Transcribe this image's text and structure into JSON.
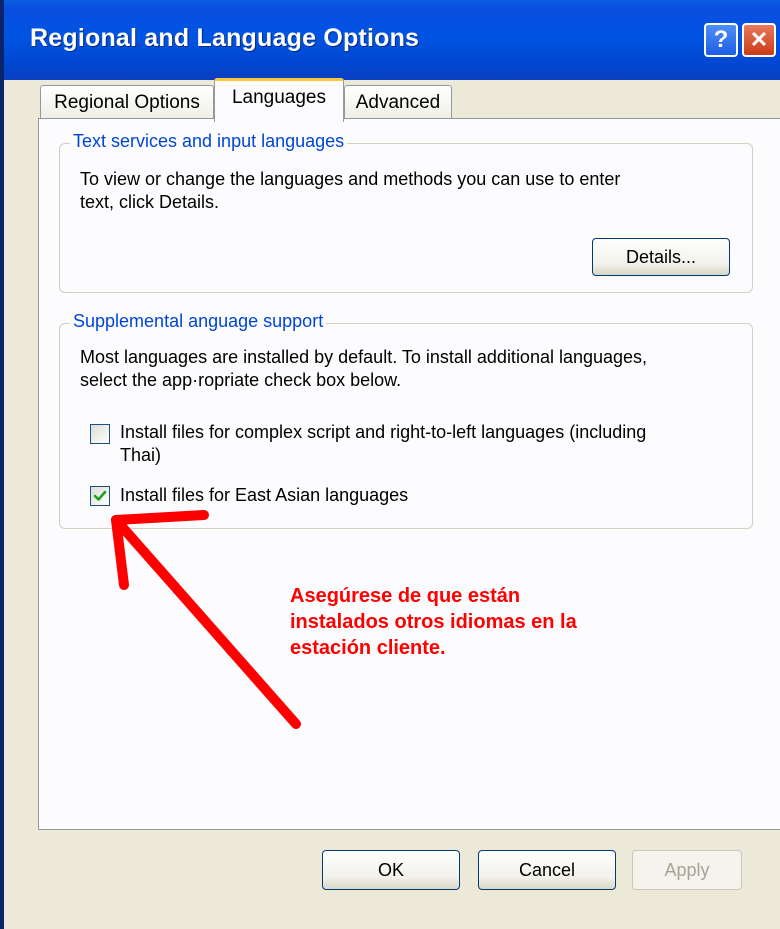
{
  "window": {
    "title": "Regional and Language Options",
    "help_glyph": "?",
    "close_glyph": "✕"
  },
  "tabs": [
    {
      "label": "Regional Options",
      "selected": false
    },
    {
      "label": "Languages",
      "selected": true
    },
    {
      "label": "Advanced",
      "selected": false
    }
  ],
  "text_services": {
    "legend": "Text services and input languages",
    "line1": "To view or change the languages and methods you can use to enter",
    "line2": "text, click Details.",
    "details_button": "Details..."
  },
  "supplemental": {
    "legend": "Supplemental anguage support",
    "line1": "Most languages are installed by default. To install additional languages,",
    "line2": "select the app·ropriate check box below.",
    "checkbox1": {
      "line1": "Install files for complex script and right-to-left languages (including",
      "line2": "Thai)",
      "checked": false
    },
    "checkbox2": {
      "label": "Install files for East Asian languages",
      "checked": true
    }
  },
  "annotation": {
    "line1": "Asegúrese de que están",
    "line2": "instalados otros idiomas en la",
    "line3": "estación cliente.",
    "color": "#ff0000"
  },
  "buttons": {
    "ok": "OK",
    "cancel": "Cancel",
    "apply": "Apply"
  },
  "colors": {
    "titlebar": "#0054e3",
    "legend_text": "#0046d5",
    "tab_highlight": "#ffc73c",
    "check_mark": "#21a121"
  }
}
